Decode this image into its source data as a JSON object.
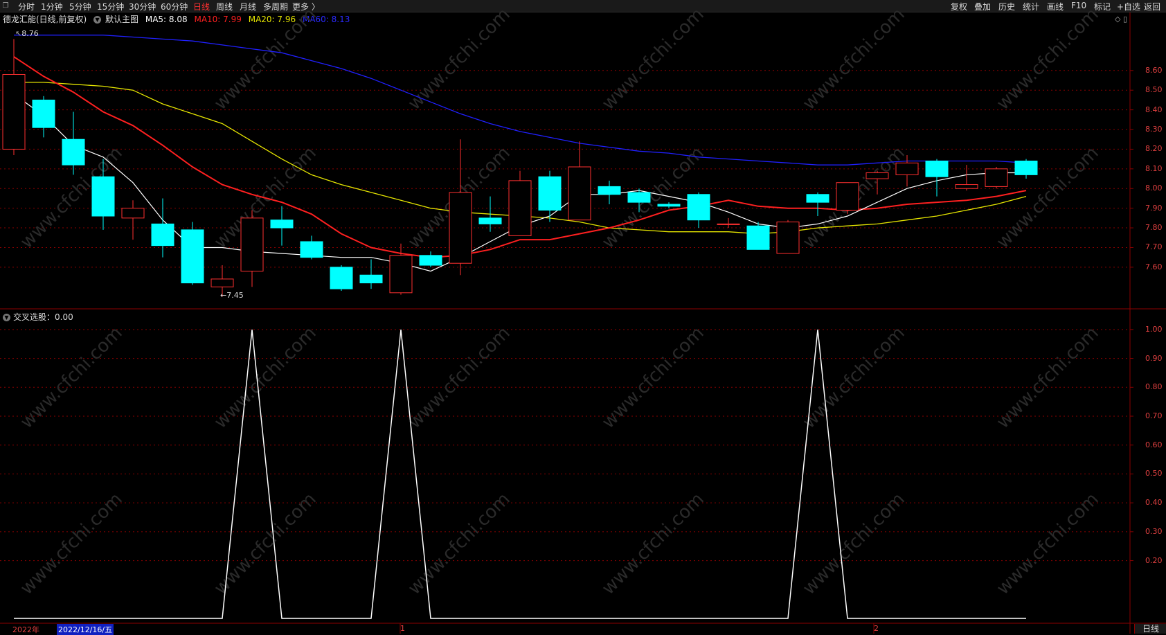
{
  "toolbar": {
    "corner_icon": "restore-icon",
    "periods": [
      "分时",
      "1分钟",
      "5分钟",
      "15分钟",
      "30分钟",
      "60分钟",
      "日线",
      "周线",
      "月线",
      "多周期",
      "更多 〉"
    ],
    "active_period": "日线",
    "right_items": [
      "复权",
      "叠加",
      "历史",
      "统计",
      "画线",
      "F10",
      "标记",
      "+自选",
      "返回"
    ]
  },
  "info": {
    "stock_name": "德龙汇能(日线,前复权)",
    "main_chart": "默认主图",
    "ma5": "MA5: 8.08",
    "ma10": "MA10: 7.99",
    "ma20": "MA20: 7.96",
    "ma60": "MA60: 8.13"
  },
  "indicator": {
    "label": "交叉选股：0.00"
  },
  "annotations": {
    "high": "8.76",
    "low": "←7.45"
  },
  "axes": {
    "price_ticks": [
      "8.60",
      "8.50",
      "8.40",
      "8.30",
      "8.20",
      "8.10",
      "8.00",
      "7.90",
      "7.80",
      "7.70",
      "7.60"
    ],
    "indicator_ticks": [
      "1.00",
      "0.90",
      "0.80",
      "0.70",
      "0.60",
      "0.50",
      "0.40",
      "0.30",
      "0.20"
    ]
  },
  "bottom": {
    "year": "2022年",
    "cursor_date": "2022/12/16/五",
    "month1": "1",
    "month2": "2",
    "cycle": "日线"
  },
  "watermark": "www.cfchi.com",
  "colors": {
    "up": "#ff3030",
    "down": "#00ffff",
    "ma5": "#ffffff",
    "ma10": "#ff2020",
    "ma20": "#e6e600",
    "ma60": "#2020ff",
    "grid": "#8b0000"
  },
  "chart_data": {
    "type": "candlestick",
    "ylim": [
      7.42,
      8.8
    ],
    "candles": [
      {
        "o": 8.2,
        "c": 8.58,
        "h": 8.76,
        "l": 8.17
      },
      {
        "o": 8.45,
        "c": 8.31,
        "h": 8.47,
        "l": 8.26
      },
      {
        "o": 8.25,
        "c": 8.12,
        "h": 8.39,
        "l": 8.07
      },
      {
        "o": 8.06,
        "c": 7.86,
        "h": 8.15,
        "l": 7.79
      },
      {
        "o": 7.85,
        "c": 7.9,
        "h": 7.94,
        "l": 7.74
      },
      {
        "o": 7.82,
        "c": 7.71,
        "h": 7.95,
        "l": 7.65
      },
      {
        "o": 7.79,
        "c": 7.52,
        "h": 7.83,
        "l": 7.51
      },
      {
        "o": 7.5,
        "c": 7.54,
        "h": 7.61,
        "l": 7.45
      },
      {
        "o": 7.58,
        "c": 7.85,
        "h": 7.89,
        "l": 7.5
      },
      {
        "o": 7.84,
        "c": 7.8,
        "h": 7.91,
        "l": 7.71
      },
      {
        "o": 7.73,
        "c": 7.65,
        "h": 7.76,
        "l": 7.64
      },
      {
        "o": 7.6,
        "c": 7.49,
        "h": 7.61,
        "l": 7.48
      },
      {
        "o": 7.56,
        "c": 7.52,
        "h": 7.64,
        "l": 7.49
      },
      {
        "o": 7.47,
        "c": 7.66,
        "h": 7.72,
        "l": 7.46
      },
      {
        "o": 7.66,
        "c": 7.61,
        "h": 7.68,
        "l": 7.6
      },
      {
        "o": 7.62,
        "c": 7.98,
        "h": 8.25,
        "l": 7.56
      },
      {
        "o": 7.85,
        "c": 7.82,
        "h": 7.96,
        "l": 7.78
      },
      {
        "o": 7.76,
        "c": 8.04,
        "h": 8.09,
        "l": 7.76
      },
      {
        "o": 8.06,
        "c": 7.89,
        "h": 8.09,
        "l": 7.83
      },
      {
        "o": 7.84,
        "c": 8.11,
        "h": 8.24,
        "l": 7.84
      },
      {
        "o": 8.01,
        "c": 7.97,
        "h": 8.04,
        "l": 7.92
      },
      {
        "o": 7.98,
        "c": 7.93,
        "h": 8.0,
        "l": 7.88
      },
      {
        "o": 7.92,
        "c": 7.91,
        "h": 7.93,
        "l": 7.9
      },
      {
        "o": 7.97,
        "c": 7.84,
        "h": 7.98,
        "l": 7.8
      },
      {
        "o": 7.82,
        "c": 7.82,
        "h": 7.85,
        "l": 7.8
      },
      {
        "o": 7.81,
        "c": 7.69,
        "h": 7.83,
        "l": 7.69
      },
      {
        "o": 7.67,
        "c": 7.83,
        "h": 7.84,
        "l": 7.67
      },
      {
        "o": 7.97,
        "c": 7.93,
        "h": 7.98,
        "l": 7.86
      },
      {
        "o": 7.89,
        "c": 8.03,
        "h": 8.03,
        "l": 7.87
      },
      {
        "o": 8.05,
        "c": 8.08,
        "h": 8.09,
        "l": 7.97
      },
      {
        "o": 8.07,
        "c": 8.13,
        "h": 8.17,
        "l": 8.01
      },
      {
        "o": 8.14,
        "c": 8.06,
        "h": 8.15,
        "l": 7.96
      },
      {
        "o": 8.0,
        "c": 8.02,
        "h": 8.12,
        "l": 7.99
      },
      {
        "o": 8.01,
        "c": 8.1,
        "h": 8.11,
        "l": 8.0
      },
      {
        "o": 8.14,
        "c": 8.07,
        "h": 8.15,
        "l": 8.05
      }
    ],
    "ma5": [
      8.48,
      8.37,
      8.22,
      8.16,
      8.03,
      7.84,
      7.7,
      7.7,
      7.68,
      7.67,
      7.66,
      7.65,
      7.65,
      7.62,
      7.58,
      7.65,
      7.73,
      7.81,
      7.86,
      7.97,
      7.97,
      7.99,
      7.96,
      7.93,
      7.88,
      7.82,
      7.8,
      7.82,
      7.86,
      7.93,
      8.0,
      8.04,
      8.07,
      8.08,
      8.08
    ],
    "ma10": [
      8.67,
      8.57,
      8.49,
      8.39,
      8.32,
      8.22,
      8.11,
      8.02,
      7.97,
      7.93,
      7.87,
      7.77,
      7.7,
      7.67,
      7.65,
      7.66,
      7.69,
      7.74,
      7.74,
      7.77,
      7.8,
      7.84,
      7.89,
      7.91,
      7.94,
      7.91,
      7.9,
      7.9,
      7.89,
      7.9,
      7.92,
      7.93,
      7.94,
      7.96,
      7.99
    ],
    "ma20": [
      8.54,
      8.54,
      8.53,
      8.52,
      8.5,
      8.43,
      8.38,
      8.33,
      8.24,
      8.15,
      8.07,
      8.02,
      7.98,
      7.94,
      7.9,
      7.88,
      7.87,
      7.86,
      7.85,
      7.83,
      7.8,
      7.79,
      7.78,
      7.78,
      7.78,
      7.77,
      7.78,
      7.8,
      7.81,
      7.82,
      7.84,
      7.86,
      7.89,
      7.92,
      7.96
    ],
    "ma60": [
      8.78,
      8.78,
      8.78,
      8.78,
      8.77,
      8.76,
      8.75,
      8.73,
      8.71,
      8.69,
      8.65,
      8.61,
      8.56,
      8.5,
      8.44,
      8.38,
      8.33,
      8.29,
      8.26,
      8.23,
      8.21,
      8.19,
      8.18,
      8.16,
      8.15,
      8.14,
      8.13,
      8.12,
      8.12,
      8.13,
      8.14,
      8.14,
      8.14,
      8.14,
      8.13
    ],
    "signal": [
      0,
      0,
      0,
      0,
      0,
      0,
      0,
      0,
      1,
      0,
      0,
      0,
      0,
      1,
      0,
      0,
      0,
      0,
      0,
      0,
      0,
      0,
      0,
      0,
      0,
      0,
      0,
      1,
      0,
      0,
      0,
      0,
      0,
      0,
      0
    ],
    "signal_ylim": [
      0,
      1.05
    ]
  }
}
